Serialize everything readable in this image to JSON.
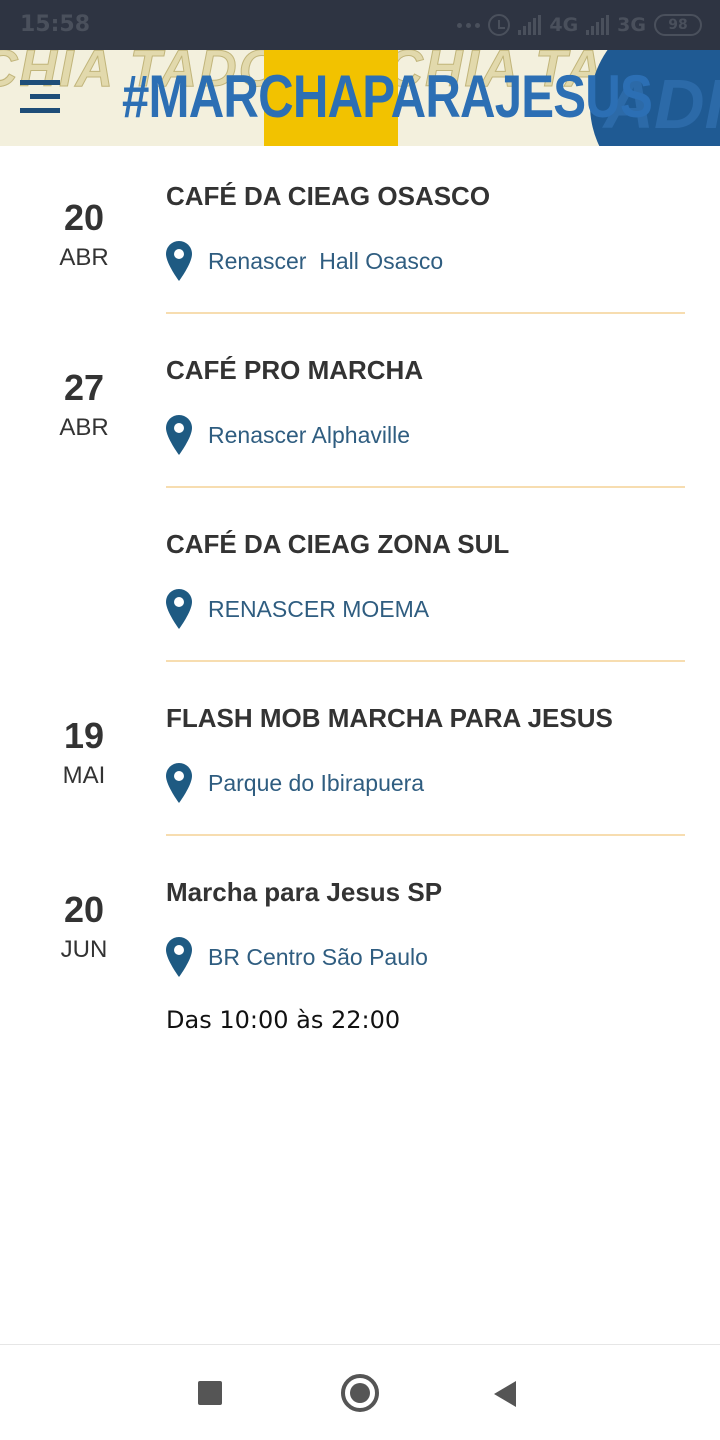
{
  "status_bar": {
    "time": "15:58",
    "network_1": "4G",
    "network_2": "3G",
    "battery": "98"
  },
  "header": {
    "title": "#MARCHAPARAJESUS",
    "pattern_text": "CHIA TADO SP CHIA TADO SP CHIA TADO SP",
    "side_text": "ADI",
    "menu_icon": "hamburger-menu-icon",
    "colors": {
      "title": "#2c6fb4",
      "yellow": "#f2c200",
      "blue": "#1f5a93"
    }
  },
  "events": [
    {
      "day": "20",
      "month": "ABR",
      "title": "CAFÉ DA CIEAG OSASCO",
      "location": "Renascer  Hall Osasco",
      "time": ""
    },
    {
      "day": "27",
      "month": "ABR",
      "title": "CAFÉ PRO MARCHA",
      "location": "Renascer Alphaville",
      "time": ""
    },
    {
      "day": "",
      "month": "",
      "title": "CAFÉ DA CIEAG ZONA SUL",
      "location": "RENASCER MOEMA",
      "time": ""
    },
    {
      "day": "19",
      "month": "MAI",
      "title": "FLASH MOB MARCHA PARA JESUS",
      "location": "Parque do Ibirapuera",
      "time": ""
    },
    {
      "day": "20",
      "month": "JUN",
      "title": "Marcha para Jesus SP",
      "location": "BR Centro São Paulo",
      "time": "Das 10:00 às 22:00"
    }
  ],
  "icons": {
    "location": "map-pin-icon",
    "nav_recent": "square-icon",
    "nav_home": "circle-home-icon",
    "nav_back": "triangle-back-icon"
  },
  "colors": {
    "divider": "#f7ddb0",
    "location_text": "#2f5d80",
    "pin": "#1e5a82",
    "status_bar": "#2e3442"
  }
}
